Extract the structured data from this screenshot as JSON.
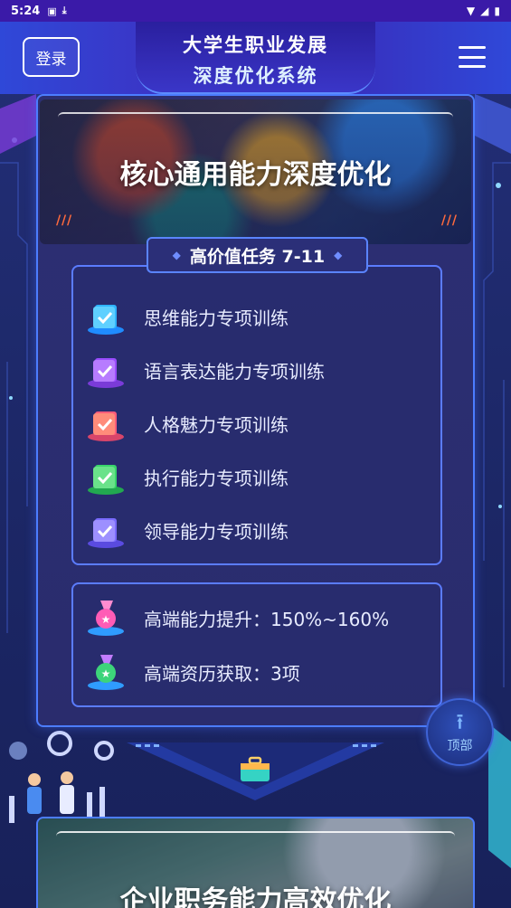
{
  "status_bar": {
    "time": "5:24",
    "icons": [
      "notification-a-icon",
      "download-icon",
      "wifi-icon",
      "signal-icon",
      "battery-icon"
    ]
  },
  "header": {
    "login_label": "登录",
    "title_line1": "大学生职业发展",
    "title_line2": "深度优化系统",
    "menu_icon": "hamburger-menu-icon"
  },
  "section1": {
    "banner_title": "核心通用能力深度优化",
    "subtitle": "高价值任务 7-11",
    "tasks": [
      {
        "label": "思维能力专项训练",
        "icon": "checkbook-icon",
        "color": "#2fb4ff"
      },
      {
        "label": "语言表达能力专项训练",
        "icon": "checkbook-icon",
        "color": "#9a4cff"
      },
      {
        "label": "人格魅力专项训练",
        "icon": "checkbook-icon",
        "color": "#ff5c7a"
      },
      {
        "label": "执行能力专项训练",
        "icon": "checkbook-icon",
        "color": "#38d46a"
      },
      {
        "label": "领导能力专项训练",
        "icon": "checkbook-icon",
        "color": "#7a6bff"
      }
    ],
    "stats": [
      {
        "label": "高端能力提升：150%~160%",
        "icon": "medal-icon",
        "color": "#ff5cb6"
      },
      {
        "label": "高端资历获取：3项",
        "icon": "medal-icon",
        "color": "#3dd47a"
      }
    ]
  },
  "back_to_top": {
    "label": "顶部",
    "icon": "arrow-up-icon"
  },
  "section2": {
    "banner_title": "企业职务能力高效优化"
  },
  "colors": {
    "accent": "#4c7dff",
    "header": "#3a2ab8",
    "background": "#1f2a6b"
  }
}
